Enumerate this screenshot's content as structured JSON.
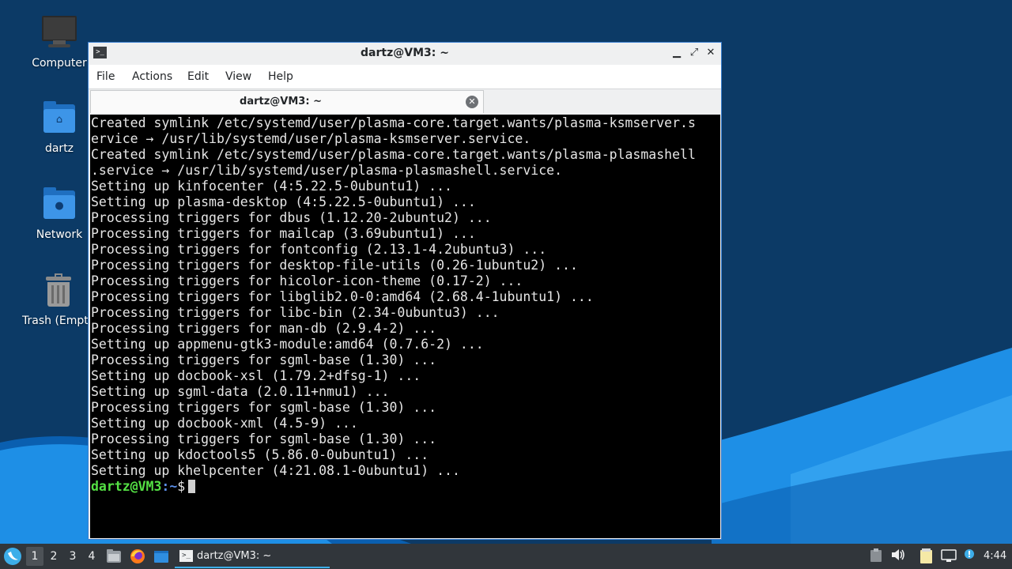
{
  "colors": {
    "wallpaper_dark": "#0c3a66",
    "wallpaper_wave": "#1e8fe6",
    "accent": "#3daee9",
    "prompt_user": "#54e044",
    "prompt_path": "#5c8fe8",
    "taskbar": "#31363b"
  },
  "desktop": {
    "icons": [
      {
        "label": "Computer",
        "icon": "computer-icon"
      },
      {
        "label": "dartz",
        "icon": "home-folder-icon"
      },
      {
        "label": "Network",
        "icon": "network-folder-icon"
      },
      {
        "label": "Trash (Empty)",
        "icon": "trash-icon"
      }
    ]
  },
  "window": {
    "title": "dartz@VM3: ~",
    "menu": [
      "File",
      "Actions",
      "Edit",
      "View",
      "Help"
    ],
    "tab_label": "dartz@VM3: ~"
  },
  "terminal": {
    "lines": [
      "Created symlink /etc/systemd/user/plasma-core.target.wants/plasma-ksmserver.s",
      "ervice → /usr/lib/systemd/user/plasma-ksmserver.service.",
      "Created symlink /etc/systemd/user/plasma-core.target.wants/plasma-plasmashell",
      ".service → /usr/lib/systemd/user/plasma-plasmashell.service.",
      "Setting up kinfocenter (4:5.22.5-0ubuntu1) ...",
      "Setting up plasma-desktop (4:5.22.5-0ubuntu1) ...",
      "Processing triggers for dbus (1.12.20-2ubuntu2) ...",
      "Processing triggers for mailcap (3.69ubuntu1) ...",
      "Processing triggers for fontconfig (2.13.1-4.2ubuntu3) ...",
      "Processing triggers for desktop-file-utils (0.26-1ubuntu2) ...",
      "Processing triggers for hicolor-icon-theme (0.17-2) ...",
      "Processing triggers for libglib2.0-0:amd64 (2.68.4-1ubuntu1) ...",
      "Processing triggers for libc-bin (2.34-0ubuntu3) ...",
      "Processing triggers for man-db (2.9.4-2) ...",
      "Setting up appmenu-gtk3-module:amd64 (0.7.6-2) ...",
      "Processing triggers for sgml-base (1.30) ...",
      "Setting up docbook-xsl (1.79.2+dfsg-1) ...",
      "Setting up sgml-data (2.0.11+nmu1) ...",
      "Processing triggers for sgml-base (1.30) ...",
      "Setting up docbook-xml (4.5-9) ...",
      "Processing triggers for sgml-base (1.30) ...",
      "Setting up kdoctools5 (5.86.0-0ubuntu1) ...",
      "Setting up khelpcenter (4:21.08.1-0ubuntu1) ..."
    ],
    "prompt_user": "dartz@VM3",
    "prompt_path": ":~",
    "prompt_symbol": "$"
  },
  "taskbar": {
    "workspaces": [
      "1",
      "2",
      "3",
      "4"
    ],
    "active_workspace": "1",
    "task_title": "dartz@VM3: ~",
    "clock": "4:44"
  }
}
